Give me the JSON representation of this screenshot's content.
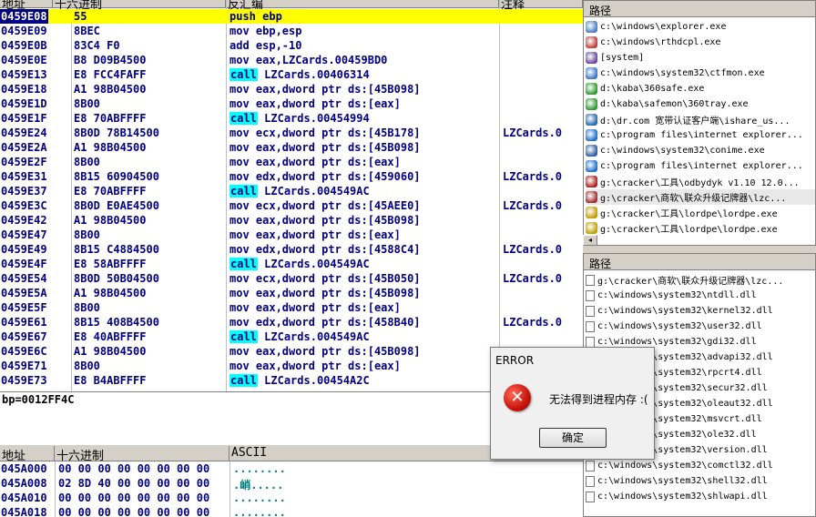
{
  "disasm": {
    "headers": {
      "addr": "地址",
      "hex": "十六进制",
      "dis": "反汇编",
      "com": "注释"
    },
    "rows": [
      {
        "addr": "0459E08",
        "hex": "55",
        "dis": "push ebp",
        "com": "",
        "call": false,
        "sel": true
      },
      {
        "addr": "0459E09",
        "hex": "8BEC",
        "dis": "mov ebp,esp",
        "com": "",
        "call": false
      },
      {
        "addr": "0459E0B",
        "hex": "83C4 F0",
        "dis": "add esp,-10",
        "com": "",
        "call": false
      },
      {
        "addr": "0459E0E",
        "hex": "B8 D09B4500",
        "dis": "mov eax,LZCards.00459BD0",
        "com": "",
        "call": false
      },
      {
        "addr": "0459E13",
        "hex": "E8 FCC4FAFF",
        "dis": "LZCards.00406314",
        "com": "",
        "call": true
      },
      {
        "addr": "0459E18",
        "hex": "A1 98B04500",
        "dis": "mov eax,dword ptr ds:[45B098]",
        "com": "",
        "call": false
      },
      {
        "addr": "0459E1D",
        "hex": "8B00",
        "dis": "mov eax,dword ptr ds:[eax]",
        "com": "",
        "call": false
      },
      {
        "addr": "0459E1F",
        "hex": "E8 70ABFFFF",
        "dis": "LZCards.00454994",
        "com": "",
        "call": true
      },
      {
        "addr": "0459E24",
        "hex": "8B0D 78B14500",
        "dis": "mov ecx,dword ptr ds:[45B178]",
        "com": "LZCards.0",
        "call": false
      },
      {
        "addr": "0459E2A",
        "hex": "A1 98B04500",
        "dis": "mov eax,dword ptr ds:[45B098]",
        "com": "",
        "call": false
      },
      {
        "addr": "0459E2F",
        "hex": "8B00",
        "dis": "mov eax,dword ptr ds:[eax]",
        "com": "",
        "call": false
      },
      {
        "addr": "0459E31",
        "hex": "8B15 60904500",
        "dis": "mov edx,dword ptr ds:[459060]",
        "com": "LZCards.0",
        "call": false
      },
      {
        "addr": "0459E37",
        "hex": "E8 70ABFFFF",
        "dis": "LZCards.004549AC",
        "com": "",
        "call": true
      },
      {
        "addr": "0459E3C",
        "hex": "8B0D E0AE4500",
        "dis": "mov ecx,dword ptr ds:[45AEE0]",
        "com": "LZCards.0",
        "call": false
      },
      {
        "addr": "0459E42",
        "hex": "A1 98B04500",
        "dis": "mov eax,dword ptr ds:[45B098]",
        "com": "",
        "call": false
      },
      {
        "addr": "0459E47",
        "hex": "8B00",
        "dis": "mov eax,dword ptr ds:[eax]",
        "com": "",
        "call": false
      },
      {
        "addr": "0459E49",
        "hex": "8B15 C4884500",
        "dis": "mov edx,dword ptr ds:[4588C4]",
        "com": "LZCards.0",
        "call": false
      },
      {
        "addr": "0459E4F",
        "hex": "E8 58ABFFFF",
        "dis": "LZCards.004549AC",
        "com": "",
        "call": true
      },
      {
        "addr": "0459E54",
        "hex": "8B0D 50B04500",
        "dis": "mov ecx,dword ptr ds:[45B050]",
        "com": "LZCards.0",
        "call": false
      },
      {
        "addr": "0459E5A",
        "hex": "A1 98B04500",
        "dis": "mov eax,dword ptr ds:[45B098]",
        "com": "",
        "call": false
      },
      {
        "addr": "0459E5F",
        "hex": "8B00",
        "dis": "mov eax,dword ptr ds:[eax]",
        "com": "",
        "call": false
      },
      {
        "addr": "0459E61",
        "hex": "8B15 408B4500",
        "dis": "mov edx,dword ptr ds:[458B40]",
        "com": "LZCards.0",
        "call": false
      },
      {
        "addr": "0459E67",
        "hex": "E8 40ABFFFF",
        "dis": "LZCards.004549AC",
        "com": "",
        "call": true
      },
      {
        "addr": "0459E6C",
        "hex": "A1 98B04500",
        "dis": "mov eax,dword ptr ds:[45B098]",
        "com": "",
        "call": false
      },
      {
        "addr": "0459E71",
        "hex": "8B00",
        "dis": "mov eax,dword ptr ds:[eax]",
        "com": "",
        "call": false
      },
      {
        "addr": "0459E73",
        "hex": "E8 B4ABFFFF",
        "dis": "LZCards.00454A2C",
        "com": "",
        "call": true
      }
    ],
    "call_kw": "call"
  },
  "info": {
    "text": "bp=0012FF4C"
  },
  "dump": {
    "headers": {
      "addr": "地址",
      "hex": "十六进制",
      "ascii": "ASCII"
    },
    "rows": [
      {
        "addr": "045A000",
        "hex": "00 00 00 00 00 00 00 00",
        "ascii": "........"
      },
      {
        "addr": "045A008",
        "hex": "02 8D 40 00 00 00 00 00",
        "ascii": ".峭....."
      },
      {
        "addr": "045A010",
        "hex": "00 00 00 00 00 00 00 00",
        "ascii": "........"
      },
      {
        "addr": "045A018",
        "hex": "00 00 00 00 00 00 00 00",
        "ascii": "........"
      }
    ]
  },
  "processes": {
    "header": "路径",
    "items": [
      {
        "path": "c:\\windows\\explorer.exe",
        "icon": "explorer-icon",
        "color": "#4a7ec8"
      },
      {
        "path": "c:\\windows\\rthdcpl.exe",
        "icon": "speaker-icon",
        "color": "#c04040"
      },
      {
        "path": "[system]",
        "icon": "system-icon",
        "color": "#6a4aa0"
      },
      {
        "path": "c:\\windows\\system32\\ctfmon.exe",
        "icon": "ctfmon-icon",
        "color": "#3a78c8"
      },
      {
        "path": "d:\\kaba\\360safe.exe",
        "icon": "360safe-icon",
        "color": "#2f9a2f"
      },
      {
        "path": "d:\\kaba\\safemon\\360tray.exe",
        "icon": "360tray-icon",
        "color": "#2f9a2f"
      },
      {
        "path": "d:\\dr.com 宽带认证客户端\\ishare_us...",
        "icon": "globe-icon",
        "color": "#2a6ab0"
      },
      {
        "path": "c:\\program files\\internet explorer...",
        "icon": "ie-icon",
        "color": "#1e70d0"
      },
      {
        "path": "c:\\windows\\system32\\conime.exe",
        "icon": "conime-icon",
        "color": "#3060a0"
      },
      {
        "path": "c:\\program files\\internet explorer...",
        "icon": "ie-icon",
        "color": "#1e70d0"
      },
      {
        "path": "g:\\cracker\\工具\\odbydyk v1.10 12.0...",
        "icon": "debugger-icon",
        "color": "#b02020"
      },
      {
        "path": "g:\\cracker\\商软\\联众升级记牌器\\lzc...",
        "icon": "lzcards-icon",
        "color": "#a03030"
      },
      {
        "path": "g:\\cracker\\工具\\lordpe\\lordpe.exe",
        "icon": "lordpe-icon",
        "color": "#c0a000"
      },
      {
        "path": "g:\\cracker\\工具\\lordpe\\lordpe.exe",
        "icon": "lordpe-icon",
        "color": "#c0a000"
      }
    ]
  },
  "modules": {
    "header": "路径",
    "items": [
      "g:\\cracker\\商软\\联众升级记牌器\\lzc...",
      "c:\\windows\\system32\\ntdll.dll",
      "c:\\windows\\system32\\kernel32.dll",
      "c:\\windows\\system32\\user32.dll",
      "c:\\windows\\system32\\gdi32.dll",
      "c:\\windows\\system32\\advapi32.dll",
      "c:\\windows\\system32\\rpcrt4.dll",
      "c:\\windows\\system32\\secur32.dll",
      "c:\\windows\\system32\\oleaut32.dll",
      "c:\\windows\\system32\\msvcrt.dll",
      "c:\\windows\\system32\\ole32.dll",
      "c:\\windows\\system32\\version.dll",
      "c:\\windows\\system32\\comctl32.dll",
      "c:\\windows\\system32\\shell32.dll",
      "c:\\windows\\system32\\shlwapi.dll"
    ]
  },
  "dialog": {
    "title": "ERROR",
    "icon_glyph": "✕",
    "message": "无法得到进程内存 :(",
    "ok": "确定"
  },
  "scroll_left_glyph": "◂"
}
